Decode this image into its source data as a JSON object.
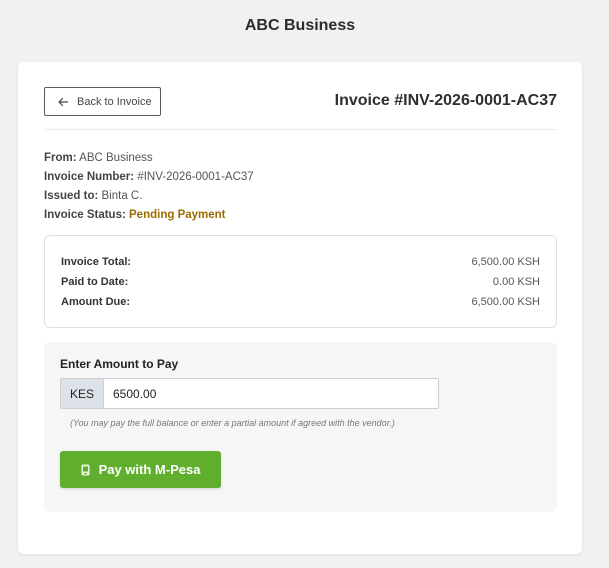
{
  "header": {
    "title": "ABC Business"
  },
  "invoice": {
    "back_label": "Back to Invoice",
    "title": "Invoice #INV-2026-0001-AC37"
  },
  "meta": {
    "from_label": "From:",
    "from_value": "ABC Business",
    "number_label": "Invoice Number:",
    "number_value": "#INV-2026-0001-AC37",
    "issued_label": "Issued to:",
    "issued_value": "Binta C.",
    "status_label": "Invoice Status:",
    "status_value": "Pending Payment"
  },
  "summary": {
    "total_label": "Invoice Total:",
    "total_value": "6,500.00 KSH",
    "paid_label": "Paid to Date:",
    "paid_value": "0.00 KSH",
    "due_label": "Amount Due:",
    "due_value": "6,500.00 KSH"
  },
  "payment": {
    "label": "Enter Amount to Pay",
    "currency": "KES",
    "amount_value": "6500.00",
    "hint": "(You may pay the full balance or enter a partial amount if agreed with the vendor.)",
    "button_label": "Pay with M-Pesa"
  },
  "colors": {
    "accent": "#5fae2d",
    "status": "#9a6b00",
    "currency_bg": "#dde2e8"
  },
  "icons": {
    "back": "arrow-left-icon",
    "pay": "phone-icon"
  }
}
